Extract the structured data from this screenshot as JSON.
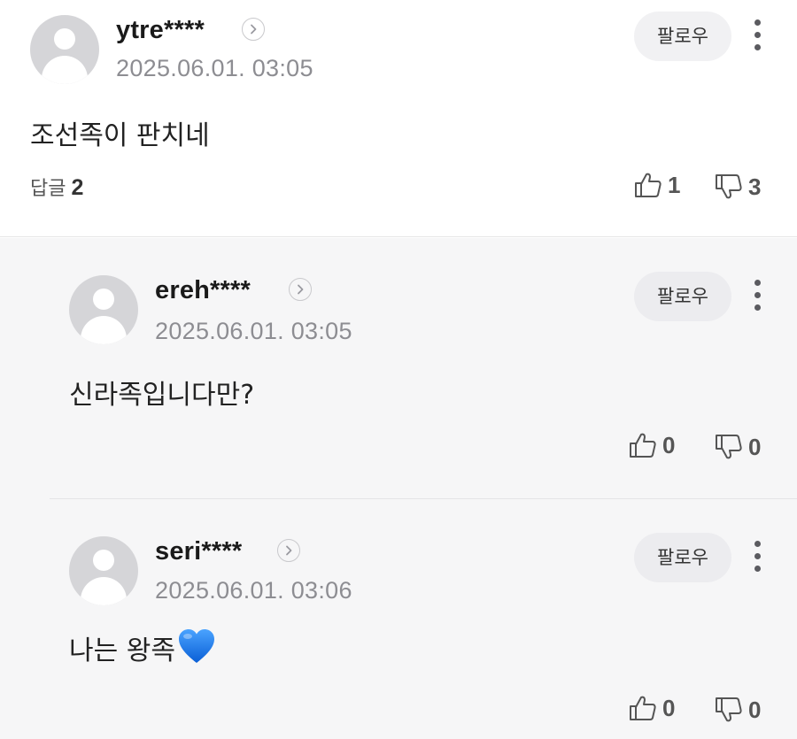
{
  "comment": {
    "username": "ytre****",
    "timestamp": "2025.06.01. 03:05",
    "follow_label": "팔로우",
    "text": "조선족이 판치네",
    "reply_label": "답글",
    "reply_count": "2",
    "likes": "1",
    "dislikes": "3"
  },
  "replies": [
    {
      "username": "ereh****",
      "timestamp": "2025.06.01. 03:05",
      "follow_label": "팔로우",
      "text": "신라족입니다만?",
      "likes": "0",
      "dislikes": "0"
    },
    {
      "username": "seri****",
      "timestamp": "2025.06.01. 03:06",
      "follow_label": "팔로우",
      "text": "나는 왕족",
      "emoji": "blue-heart-icon",
      "likes": "0",
      "dislikes": "0"
    }
  ],
  "colors": {
    "reply_background": "#f6f6f7",
    "follow_button": "#f1f1f3",
    "heart": "#1a73e8"
  }
}
